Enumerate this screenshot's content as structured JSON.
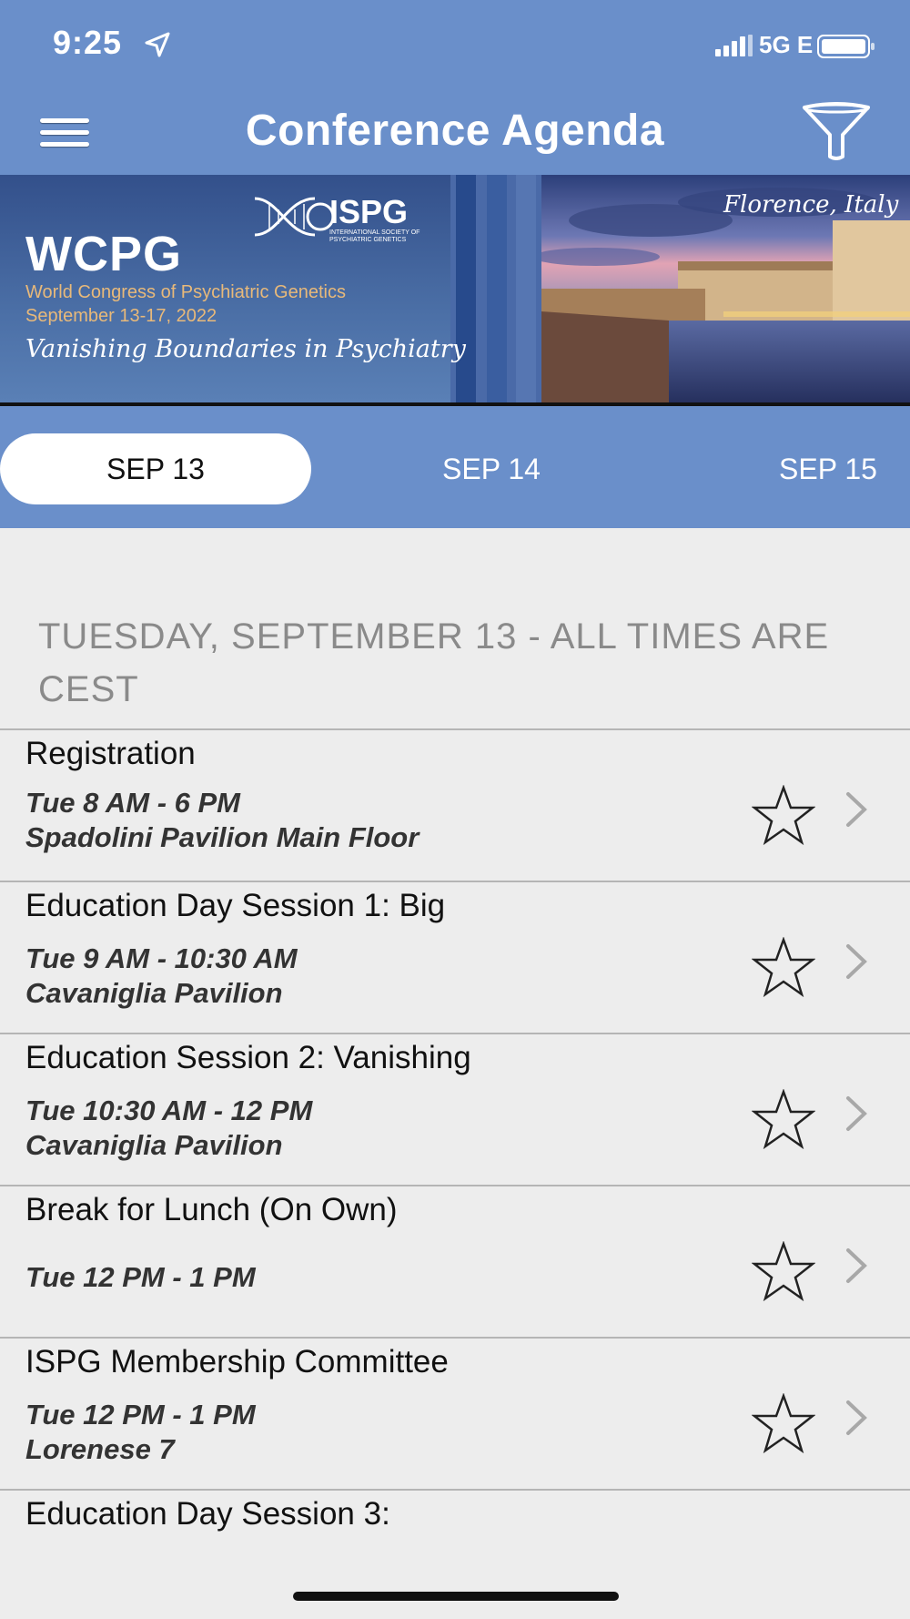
{
  "status_bar": {
    "time": "9:25",
    "network": "5G E",
    "icons": [
      "location-arrow-icon",
      "signal-icon",
      "battery-icon"
    ]
  },
  "nav": {
    "title": "Conference Agenda",
    "icons": [
      "hamburger-menu-icon",
      "filter-funnel-icon"
    ]
  },
  "banner": {
    "logo": "WCPG",
    "partner_logo": "ISPG",
    "partner_sub": "INTERNATIONAL SOCIETY OF PSYCHIATRIC GENETICS",
    "congress_name": "World Congress of Psychiatric Genetics",
    "congress_dates": "September 13-17, 2022",
    "tagline": "Vanishing Boundaries in Psychiatry",
    "location": "Florence, Italy"
  },
  "date_tabs": [
    {
      "label": "SEP 13",
      "active": true
    },
    {
      "label": "SEP 14",
      "active": false
    },
    {
      "label": "SEP 15",
      "active": false
    }
  ],
  "section_header": "TUESDAY, SEPTEMBER 13 - ALL TIMES ARE CEST",
  "sessions": [
    {
      "title": "Registration",
      "time": "Tue 8 AM - 6 PM",
      "location": "Spadolini Pavilion Main Floor"
    },
    {
      "title": "Education Day Session 1: Big",
      "time": "Tue 9 AM - 10:30 AM",
      "location": "Cavaniglia Pavilion"
    },
    {
      "title": "Education Session 2: Vanishing",
      "time": "Tue 10:30 AM - 12 PM",
      "location": "Cavaniglia Pavilion"
    },
    {
      "title": "Break for Lunch (On Own)",
      "time": "Tue 12 PM - 1 PM",
      "location": ""
    },
    {
      "title": "ISPG Membership Committee",
      "time": "Tue 12 PM - 1 PM",
      "location": "Lorenese 7"
    },
    {
      "title": "Education Day Session 3:",
      "time": "",
      "location": ""
    }
  ],
  "colors": {
    "header_blue": "#6a8fca",
    "list_background": "#ededed",
    "section_text": "#8a8a8a"
  }
}
